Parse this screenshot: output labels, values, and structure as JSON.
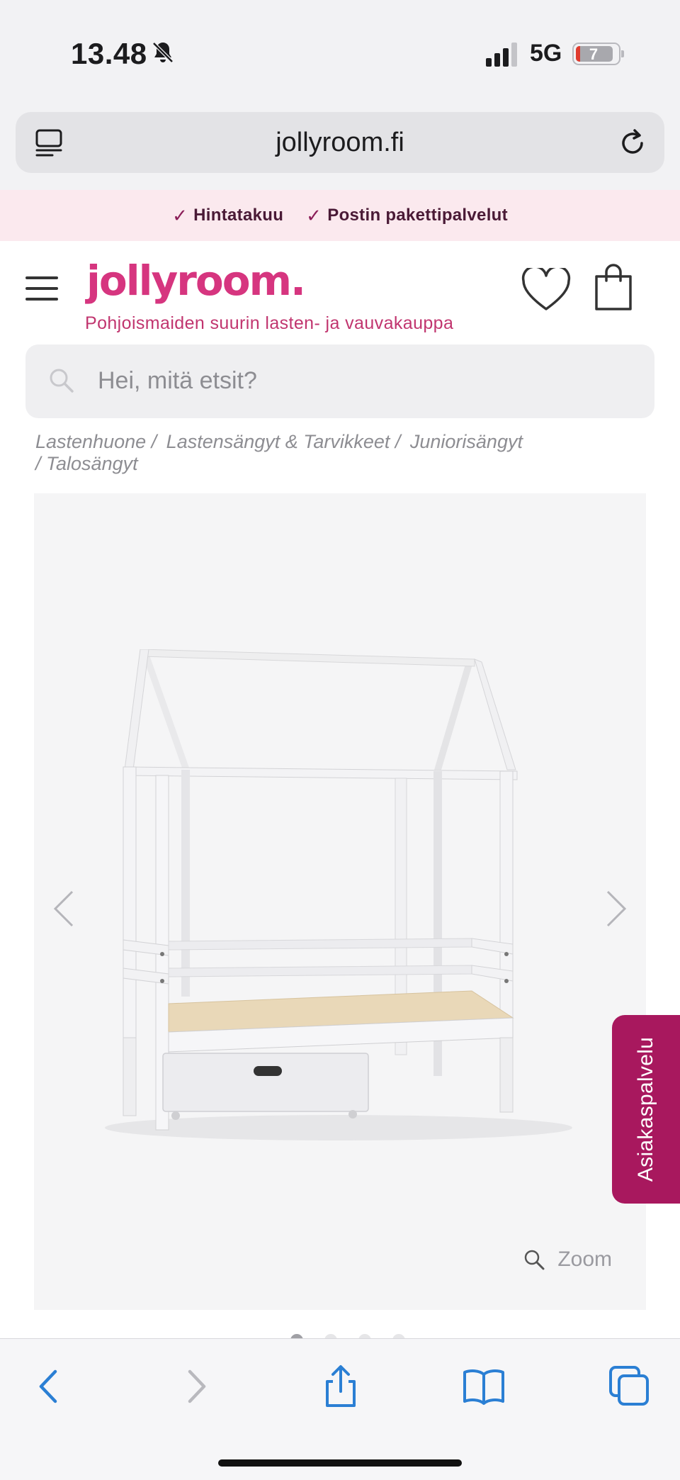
{
  "status_bar": {
    "time": "13.48",
    "network": "5G",
    "battery": "7",
    "icons": [
      "bell-slash-icon",
      "signal-icon",
      "battery-icon"
    ]
  },
  "browser": {
    "domain": "jollyroom.fi",
    "icons": [
      "tabs-overview-icon",
      "reload-icon"
    ]
  },
  "promo": {
    "items": [
      "Hintatakuu",
      "Postin pakettipalvelut"
    ]
  },
  "header": {
    "logo": "jollyroom.",
    "tagline": "Pohjoismaiden suurin lasten- ja vauvakauppa",
    "icons": [
      "hamburger-menu-icon",
      "heart-icon",
      "shopping-bag-icon"
    ]
  },
  "search": {
    "placeholder": "Hei, mitä etsit?"
  },
  "breadcrumb": [
    "Lastenhuone /",
    "Lastensängyt & Tarvikkeet /",
    "Juniorisängyt",
    "/  Talosängyt"
  ],
  "gallery": {
    "zoom_label": "Zoom",
    "slide_count": 4,
    "active_slide": 1
  },
  "customer_service": {
    "label": "Asiakaspalvelu"
  },
  "toolbar": {
    "icons": [
      "back-icon",
      "forward-icon",
      "share-icon",
      "bookmarks-icon",
      "tabs-icon"
    ]
  },
  "colors": {
    "brand": "#d6357f",
    "brand_dark": "#a8185e",
    "promo_bg": "#fbe9ee",
    "ios_blue": "#2b7fd4"
  }
}
